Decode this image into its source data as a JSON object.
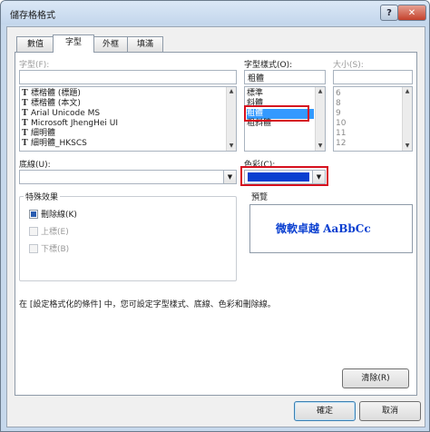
{
  "window": {
    "title": "儲存格格式",
    "help_button": "?",
    "close_button": "✕"
  },
  "tabs": [
    {
      "label": "數值"
    },
    {
      "label": "字型"
    },
    {
      "label": "外框"
    },
    {
      "label": "填滿"
    }
  ],
  "font": {
    "label": "字型(F):",
    "value": "",
    "items": [
      "標楷體 (標題)",
      "標楷體 (本文)",
      "Arial Unicode MS",
      "Microsoft JhengHei UI",
      "細明體",
      "細明體_HKSCS"
    ]
  },
  "style": {
    "label": "字型樣式(O):",
    "value": "粗體",
    "items": [
      "標準",
      "斜體",
      "粗體",
      "粗斜體"
    ],
    "selected_index": 2
  },
  "size": {
    "label": "大小(S):",
    "value": "",
    "items": [
      "6",
      "8",
      "9",
      "10",
      "11",
      "12"
    ]
  },
  "underline": {
    "label": "底線(U):",
    "value": ""
  },
  "color": {
    "label": "色彩(C):",
    "swatch": "#0a3fd0"
  },
  "effects": {
    "legend": "特殊效果",
    "strikethrough": "刪除線(K)",
    "superscript": "上標(E)",
    "subscript": "下標(B)"
  },
  "preview": {
    "legend": "預覽",
    "text": "微軟卓越  AaBbCc",
    "text_color": "#0a3fd0"
  },
  "hint": "在 [設定格式化的條件] 中，您可設定字型樣式、底線、色彩和刪除線。",
  "buttons": {
    "clear": "清除(R)",
    "ok": "確定",
    "cancel": "取消"
  },
  "icons": {
    "truetype": "T",
    "scroll_up": "▲",
    "scroll_down": "▼",
    "dropdown": "▼"
  }
}
